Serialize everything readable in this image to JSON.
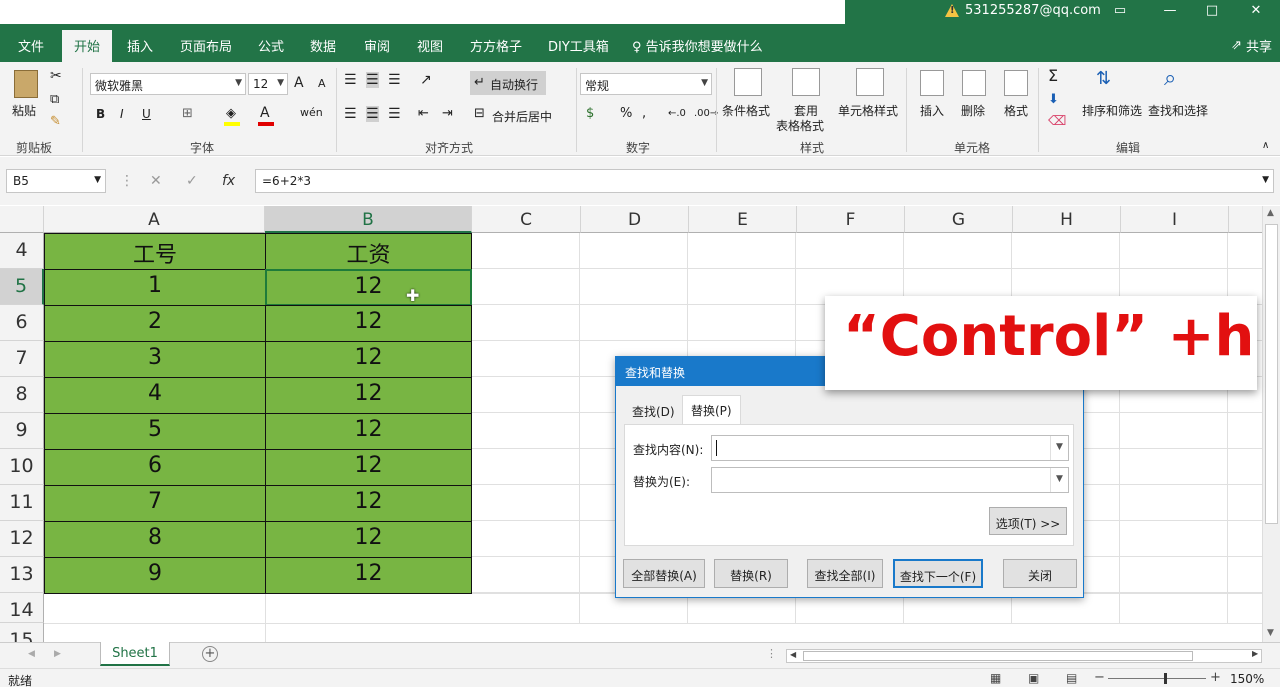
{
  "titlebar": {
    "account": "531255287@qq.com"
  },
  "tabs": [
    "文件",
    "开始",
    "插入",
    "页面布局",
    "公式",
    "数据",
    "审阅",
    "视图",
    "方方格子",
    "DIY工具箱"
  ],
  "tell_me": "告诉我你想要做什么",
  "share_label": "共享",
  "ribbon": {
    "clipboard": {
      "paste": "粘贴",
      "label": "剪贴板"
    },
    "font": {
      "name": "微软雅黑",
      "size": "12",
      "bold": "B",
      "italic": "I",
      "underline": "U",
      "grow": "A",
      "shrink": "A",
      "label": "字体"
    },
    "align": {
      "wrap": "自动换行",
      "merge": "合并后居中",
      "label": "对齐方式"
    },
    "number": {
      "format": "常规",
      "percent": "%",
      "comma": ",",
      "label": "数字"
    },
    "styles": {
      "conditional": "条件格式",
      "table_l1": "套用",
      "table_l2": "表格格式",
      "cell_styles": "单元格样式",
      "label": "样式"
    },
    "cells": {
      "insert": "插入",
      "delete": "删除",
      "format": "格式",
      "label": "单元格"
    },
    "editing": {
      "sort": "排序和筛选",
      "find": "查找和选择",
      "label": "编辑"
    }
  },
  "formula_bar": {
    "name_box": "B5",
    "formula": "=6+2*3",
    "fx": "fx"
  },
  "columns": [
    "A",
    "B",
    "C",
    "D",
    "E",
    "F",
    "G",
    "H",
    "I"
  ],
  "rows": [
    "4",
    "5",
    "6",
    "7",
    "8",
    "9",
    "10",
    "11",
    "12",
    "13",
    "14",
    "15"
  ],
  "table": {
    "headers": [
      "工号",
      "工资"
    ],
    "rows": [
      [
        "1",
        "12"
      ],
      [
        "2",
        "12"
      ],
      [
        "3",
        "12"
      ],
      [
        "4",
        "12"
      ],
      [
        "5",
        "12"
      ],
      [
        "6",
        "12"
      ],
      [
        "7",
        "12"
      ],
      [
        "8",
        "12"
      ],
      [
        "9",
        "12"
      ]
    ]
  },
  "dialog": {
    "title": "查找和替换",
    "tab_find": "查找(D)",
    "tab_replace": "替换(P)",
    "find_label": "查找内容(N):",
    "replace_label": "替换为(E):",
    "find_value": "",
    "replace_value": "",
    "options": "选项(T) >>",
    "replace_all": "全部替换(A)",
    "replace": "替换(R)",
    "find_all": "查找全部(I)",
    "find_next": "查找下一个(F)",
    "close": "关闭"
  },
  "overlay_text": "“Control” +h",
  "sheet_tab": "Sheet1",
  "status": {
    "ready": "就绪",
    "zoom": "150%"
  },
  "colors": {
    "excel_green": "#227447",
    "cell_fill": "#78b543",
    "dialog_blue": "#1979ca",
    "overlay_red": "#e21010"
  }
}
